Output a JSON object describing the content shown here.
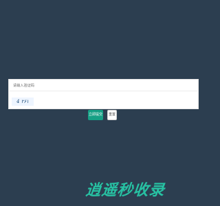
{
  "form": {
    "title": "请输入验证码",
    "captcha_text": "4 ۲۶۱",
    "submit_label": "立即提交",
    "reset_label": "重置"
  },
  "watermark": {
    "text": "逍遥秒收录"
  },
  "colors": {
    "background": "#2c3e50",
    "primary": "#16a085",
    "watermark": "#27c2a3"
  }
}
